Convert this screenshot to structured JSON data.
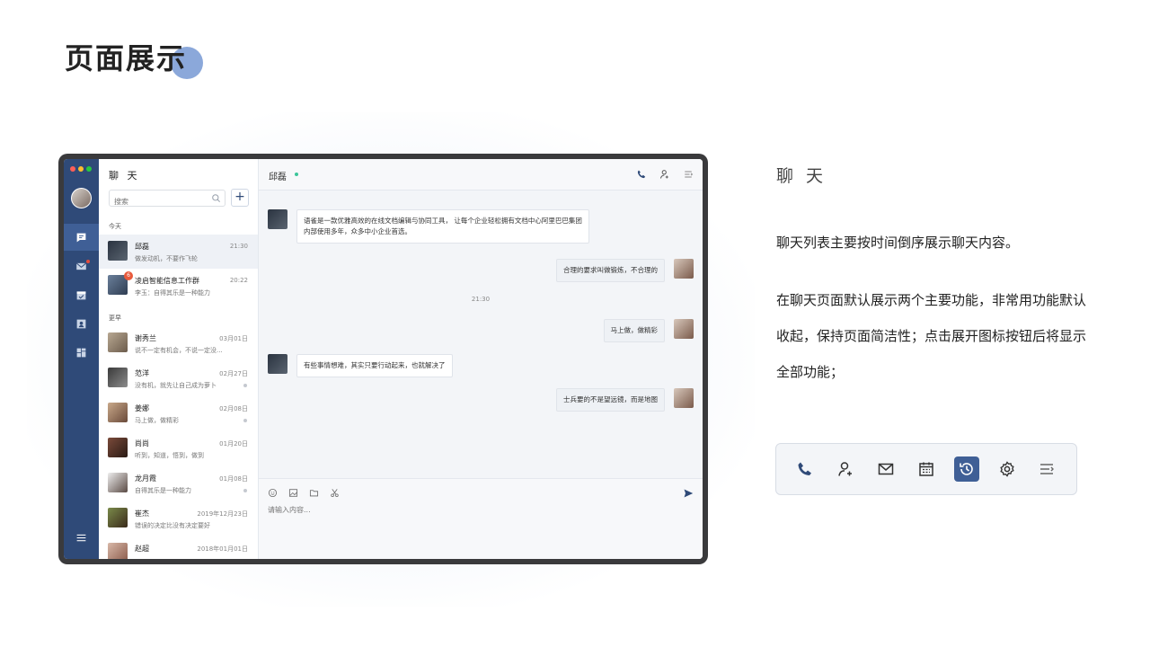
{
  "page": {
    "title": "页面展示"
  },
  "colors": {
    "accent": "#2f4a78",
    "accent_active": "#3f5f96",
    "online": "#3cc59a",
    "unread": "#e85a3c"
  },
  "app": {
    "list_title": "聊 天",
    "search_placeholder": "搜索",
    "add_label": "+",
    "sections": {
      "today": "今天",
      "earlier": "更早"
    },
    "chats": [
      {
        "name": "邱磊",
        "msg": "做发动机，不要作飞轮",
        "time": "21:30",
        "active": true
      },
      {
        "name": "凌启智能信息工作群",
        "msg": "李玉：自得其乐是一种能力",
        "time": "20:22",
        "unread": "6"
      },
      {
        "name": "谢秀兰",
        "msg": "说不一定有机会，不说一定没...",
        "time": "03月01日"
      },
      {
        "name": "范洋",
        "msg": "没有机，就先让自己成为萝卜",
        "time": "02月27日"
      },
      {
        "name": "姜娜",
        "msg": "马上做，做精彩",
        "time": "02月08日"
      },
      {
        "name": "尚尚",
        "msg": "听到，知道，悟到，做到",
        "time": "01月20日"
      },
      {
        "name": "龙月霞",
        "msg": "自得其乐是一种能力",
        "time": "01月08日"
      },
      {
        "name": "崔杰",
        "msg": "错误的决定比没有决定要好",
        "time": "2019年12月23日"
      },
      {
        "name": "赵超",
        "msg": "",
        "time": "2018年01月01日"
      }
    ],
    "conversation": {
      "name": "邱磊",
      "messages": [
        {
          "from": "other",
          "text1": "语雀是一款优雅高效的在线文档编辑与协同工具， 让每个企业轻松拥有文档中心阿里巴巴集团",
          "text2": "内部使用多年，众多中小企业首选。"
        },
        {
          "from": "me",
          "text": "合理的要求叫做锻炼，不合理的"
        },
        {
          "from": "me",
          "text": "马上做，做精彩"
        },
        {
          "from": "other",
          "text": "有些事情想难，其实只要行动起来，也就解决了"
        },
        {
          "from": "me",
          "text": "士兵要的不是望远镜，而是地图"
        }
      ],
      "timestamp": "21:30",
      "input_placeholder": "请输入内容..."
    }
  },
  "description": {
    "title": "聊 天",
    "p1": "聊天列表主要按时间倒序展示聊天内容。",
    "p2": "在聊天页面默认展示两个主要功能，非常用功能默认收起，保持页面简洁性；点击展开图标按钮后将显示全部功能；"
  },
  "toolbar_icons": [
    "phone-icon",
    "add-user-icon",
    "mail-icon",
    "calendar-icon",
    "history-icon",
    "settings-icon",
    "expand-icon"
  ],
  "toolbar_active": "history-icon"
}
